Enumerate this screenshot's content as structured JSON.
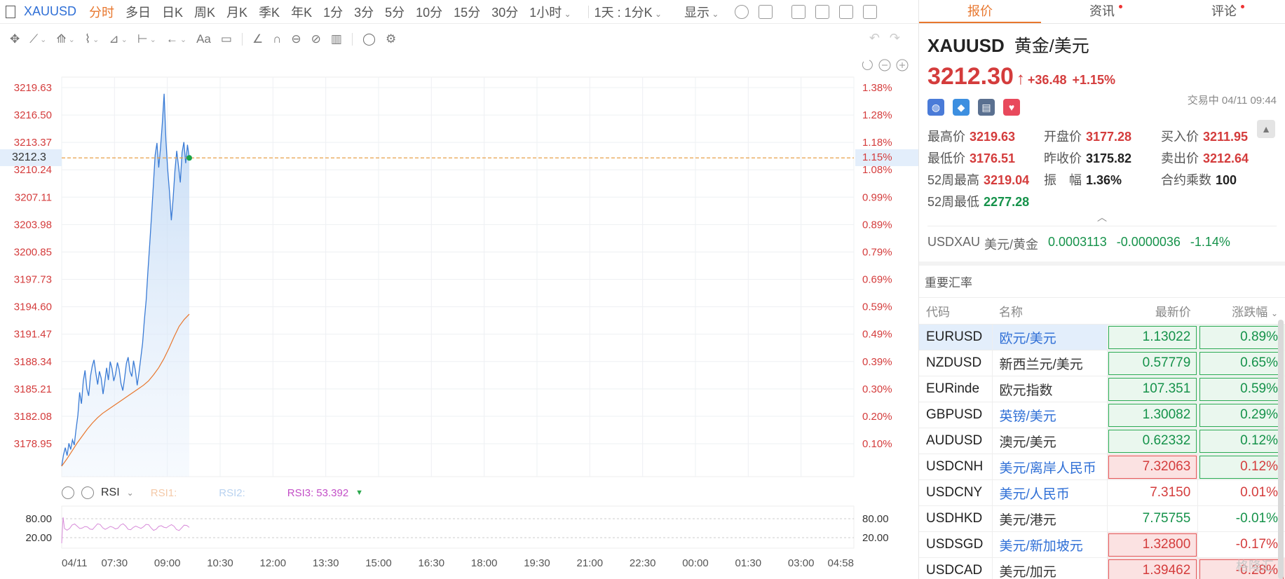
{
  "toolbar": {
    "symbol": "XAUUSD",
    "periods": [
      "分时",
      "多日",
      "日K",
      "周K",
      "月K",
      "季K",
      "年K",
      "1分",
      "3分",
      "5分",
      "10分",
      "15分",
      "30分"
    ],
    "active_period": "分时",
    "interval_select": "1小时",
    "range_select": "1天 : 1分K",
    "display_select": "显示"
  },
  "tools_row": {
    "font_label": "Aa"
  },
  "chart_data": {
    "type": "line",
    "title": "",
    "y_left_ticks": [
      "3219.63",
      "3216.50",
      "3213.37",
      "3210.24",
      "3207.11",
      "3203.98",
      "3200.85",
      "3197.73",
      "3194.60",
      "3191.47",
      "3188.34",
      "3185.21",
      "3182.08",
      "3178.95"
    ],
    "y_right_ticks": [
      "1.38%",
      "1.28%",
      "1.18%",
      "1.08%",
      "0.99%",
      "0.89%",
      "0.79%",
      "0.69%",
      "0.59%",
      "0.49%",
      "0.39%",
      "0.30%",
      "0.20%",
      "0.10%"
    ],
    "ylim": [
      3176.0,
      3221.5
    ],
    "x_ticks": [
      "04/11",
      "07:30",
      "09:00",
      "10:30",
      "12:00",
      "13:30",
      "15:00",
      "16:30",
      "18:00",
      "19:30",
      "21:00",
      "22:30",
      "00:00",
      "01:30",
      "03:00",
      "04:58"
    ],
    "last_price": 3212.3,
    "last_pct": "1.15%",
    "series": [
      {
        "values": [
          3177.2,
          3178.5,
          3179.3,
          3178.4,
          3179.8,
          3179.1,
          3180.2,
          3179.6,
          3181.4,
          3183.0,
          3185.6,
          3184.3,
          3186.9,
          3188.1,
          3186.0,
          3185.2,
          3187.4,
          3188.6,
          3189.3,
          3187.8,
          3186.5,
          3188.0,
          3187.2,
          3185.4,
          3186.8,
          3188.4,
          3187.0,
          3189.1,
          3188.3,
          3186.9,
          3187.7,
          3189.0,
          3188.2,
          3186.6,
          3185.8,
          3187.2,
          3188.9,
          3189.6,
          3188.0,
          3187.4,
          3189.2,
          3188.1,
          3186.4,
          3187.8,
          3189.5,
          3191.2,
          3193.8,
          3196.1,
          3199.4,
          3202.5,
          3205.8,
          3209.1,
          3212.6,
          3214.0,
          3211.2,
          3213.5,
          3216.2,
          3219.6,
          3214.3,
          3211.0,
          3208.4,
          3205.2,
          3207.6,
          3210.8,
          3213.1,
          3211.4,
          3209.5,
          3212.9,
          3214.1,
          3211.7,
          3213.8,
          3212.3
        ]
      },
      {
        "values": [
          3177.2,
          3178.0,
          3178.9,
          3179.8,
          3180.6,
          3181.4,
          3182.1,
          3182.7,
          3183.2,
          3183.6,
          3184.0,
          3184.4,
          3184.8,
          3185.2,
          3185.6,
          3186.0,
          3186.4,
          3186.9,
          3187.6,
          3188.4,
          3189.4,
          3190.6,
          3191.9,
          3193.1,
          3193.9,
          3194.5
        ]
      }
    ],
    "rsi": {
      "label": "RSI",
      "r1_label": "RSI1:",
      "r2_label": "RSI2:",
      "r3_label": "RSI3:",
      "r3_value": "53.392",
      "levels": [
        "80.00",
        "20.00"
      ]
    }
  },
  "panel": {
    "tabs": [
      {
        "label": "报价"
      },
      {
        "label": "资讯"
      },
      {
        "label": "评论"
      }
    ],
    "code": "XAUUSD",
    "name": "黄金/美元",
    "price": "3212.30",
    "change": "+36.48",
    "change_pct": "+1.15%",
    "status": "交易中 04/11 09:44",
    "stats": [
      {
        "label": "最高价",
        "value": "3219.63",
        "color": "red"
      },
      {
        "label": "开盘价",
        "value": "3177.28",
        "color": "red"
      },
      {
        "label": "买入价",
        "value": "3211.95",
        "color": "red"
      },
      {
        "label": "最低价",
        "value": "3176.51",
        "color": "red"
      },
      {
        "label": "昨收价",
        "value": "3175.82",
        "color": "dark"
      },
      {
        "label": "卖出价",
        "value": "3212.64",
        "color": "red"
      },
      {
        "label": "52周最高",
        "value": "3219.04",
        "color": "red"
      },
      {
        "label": "振　幅",
        "value": "1.36%",
        "color": "dark"
      },
      {
        "label": "合约乘数",
        "value": "100",
        "color": "dark"
      },
      {
        "label": "52周最低",
        "value": "2277.28",
        "color": "green"
      }
    ],
    "cross": {
      "code": "USDXAU",
      "name": "美元/黄金",
      "price": "0.0003113",
      "change": "-0.0000036",
      "pct": "-1.14%"
    },
    "rates_title": "重要汇率",
    "rates_headers": [
      "代码",
      "名称",
      "最新价",
      "涨跌幅"
    ],
    "rates": [
      {
        "code": "EURUSD",
        "name": "欧元/美元",
        "price": "1.13022",
        "pct": "0.89%",
        "dir": "up",
        "link": true,
        "box": "g",
        "sel": true
      },
      {
        "code": "NZDUSD",
        "name": "新西兰元/美元",
        "price": "0.57779",
        "pct": "0.65%",
        "dir": "up",
        "link": false,
        "box": "g"
      },
      {
        "code": "EURinde",
        "name": "欧元指数",
        "price": "107.351",
        "pct": "0.59%",
        "dir": "up",
        "link": false,
        "box": "g"
      },
      {
        "code": "GBPUSD",
        "name": "英镑/美元",
        "price": "1.30082",
        "pct": "0.29%",
        "dir": "up",
        "link": true,
        "box": "g"
      },
      {
        "code": "AUDUSD",
        "name": "澳元/美元",
        "price": "0.62332",
        "pct": "0.12%",
        "dir": "up",
        "link": false,
        "box": "g"
      },
      {
        "code": "USDCNH",
        "name": "美元/离岸人民币",
        "price": "7.32063",
        "pct": "0.12%",
        "dir": "red",
        "link": true,
        "box": "rg"
      },
      {
        "code": "USDCNY",
        "name": "美元/人民币",
        "price": "7.3150",
        "pct": "0.01%",
        "dir": "red",
        "link": true,
        "box": ""
      },
      {
        "code": "USDHKD",
        "name": "美元/港元",
        "price": "7.75755",
        "pct": "-0.01%",
        "dir": "green",
        "link": false,
        "box": ""
      },
      {
        "code": "USDSGD",
        "name": "美元/新加坡元",
        "price": "1.32800",
        "pct": "-0.17%",
        "dir": "down",
        "link": true,
        "box": "r"
      },
      {
        "code": "USDCAD",
        "name": "美元/加元",
        "price": "1.39462",
        "pct": "-0.28%",
        "dir": "down",
        "link": false,
        "box": "rr"
      }
    ],
    "watermark": "格隆汇"
  }
}
